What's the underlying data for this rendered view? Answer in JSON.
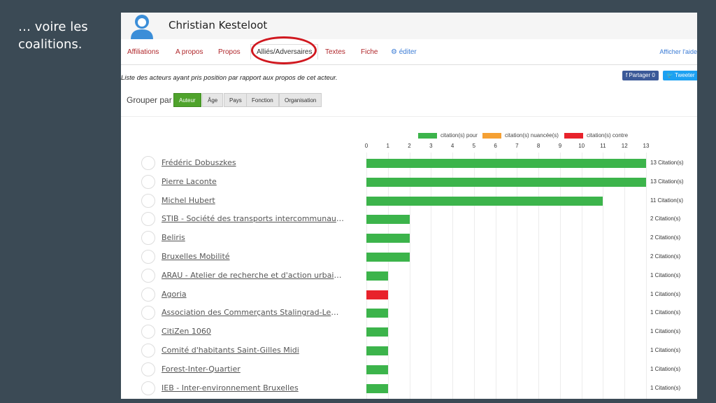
{
  "slide": {
    "caption_line1": "… voire les",
    "caption_line2": "coalitions."
  },
  "header": {
    "actor_name": "Christian Kesteloot"
  },
  "tabs": [
    {
      "label": "Affiliations"
    },
    {
      "label": "A propos"
    },
    {
      "label": "Propos"
    },
    {
      "label": "Alliés/Adversaires",
      "active": true
    },
    {
      "label": "Textes"
    },
    {
      "label": "Fiche"
    },
    {
      "label": "éditer",
      "icon": "gears-icon"
    }
  ],
  "help_link": "Afficher l'aide",
  "description": "Liste des acteurs ayant pris position par rapport aux propos de cet acteur.",
  "share": {
    "facebook": "Partager 0",
    "twitter": "Tweeter"
  },
  "group_by": {
    "label": "Grouper par",
    "options": [
      "Auteur",
      "Âge",
      "Pays",
      "Fonction",
      "Organisation"
    ],
    "selected": "Auteur"
  },
  "colors": {
    "pour": "#3cb44b",
    "nuancee": "#f5a033",
    "contre": "#e8222b"
  },
  "chart_data": {
    "type": "bar",
    "orientation": "horizontal",
    "legend": [
      "citation(s) pour",
      "citation(s) nuancée(s)",
      "citation(s) contre"
    ],
    "legend_position": "top",
    "xlim": [
      0,
      13
    ],
    "x_ticks": [
      "0",
      "1",
      "2",
      "3",
      "4",
      "5",
      "6",
      "7",
      "8",
      "9",
      "10",
      "11",
      "12",
      "13"
    ],
    "grid": true,
    "rows": [
      {
        "name": "Frédéric Dobuszkes",
        "value": 13,
        "type": "pour",
        "label": "13 Citation(s)"
      },
      {
        "name": "Pierre Laconte",
        "value": 13,
        "type": "pour",
        "label": "13 Citation(s)"
      },
      {
        "name": "Michel Hubert",
        "value": 11,
        "type": "pour",
        "label": "11 Citation(s)"
      },
      {
        "name": "STIB - Société des transports intercommunaux de ...",
        "value": 2,
        "type": "pour",
        "label": "2 Citation(s)"
      },
      {
        "name": "Beliris",
        "value": 2,
        "type": "pour",
        "label": "2 Citation(s)"
      },
      {
        "name": "Bruxelles Mobilité",
        "value": 2,
        "type": "pour",
        "label": "2 Citation(s)"
      },
      {
        "name": "ARAU - Atelier de recherche et d'action urbaines",
        "value": 1,
        "type": "pour",
        "label": "1 Citation(s)"
      },
      {
        "name": "Agoria",
        "value": 1,
        "type": "contre",
        "label": "1 Citation(s)"
      },
      {
        "name": "Association des Commerçants Stalingrad-Lemonnier",
        "value": 1,
        "type": "pour",
        "label": "1 Citation(s)"
      },
      {
        "name": "CitiZen 1060",
        "value": 1,
        "type": "pour",
        "label": "1 Citation(s)"
      },
      {
        "name": "Comité d'habitants Saint-Gilles Midi",
        "value": 1,
        "type": "pour",
        "label": "1 Citation(s)"
      },
      {
        "name": "Forest-Inter-Quartier",
        "value": 1,
        "type": "pour",
        "label": "1 Citation(s)"
      },
      {
        "name": "IEB - Inter-environnement Bruxelles",
        "value": 1,
        "type": "pour",
        "label": "1 Citation(s)"
      }
    ]
  }
}
